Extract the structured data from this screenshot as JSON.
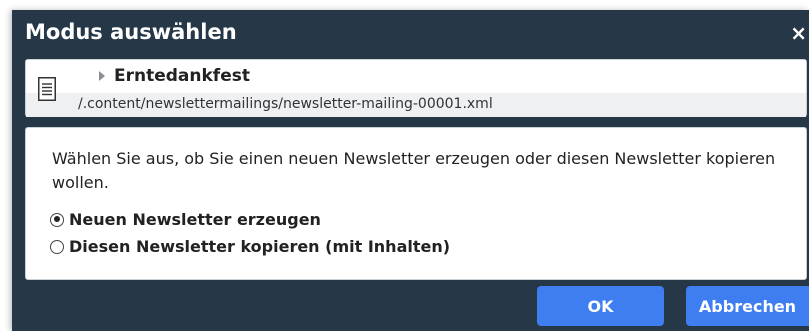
{
  "dialog": {
    "title": "Modus auswählen",
    "close_label": "×"
  },
  "resource": {
    "icon": "document-icon",
    "title": "Erntedankfest",
    "path": "/.content/newslettermailings/newsletter-mailing-00001.xml"
  },
  "content": {
    "description": "Wählen Sie aus, ob Sie einen neuen Newsletter erzeugen oder diesen Newsletter kopieren wollen.",
    "options": [
      {
        "label": "Neuen Newsletter erzeugen",
        "checked": true
      },
      {
        "label": "Diesen Newsletter kopieren (mit Inhalten)",
        "checked": false
      }
    ]
  },
  "buttons": {
    "ok_label": "OK",
    "cancel_label": "Abbrechen"
  },
  "colors": {
    "dialog_background": "#263747",
    "button_primary": "#3e7ef0"
  }
}
